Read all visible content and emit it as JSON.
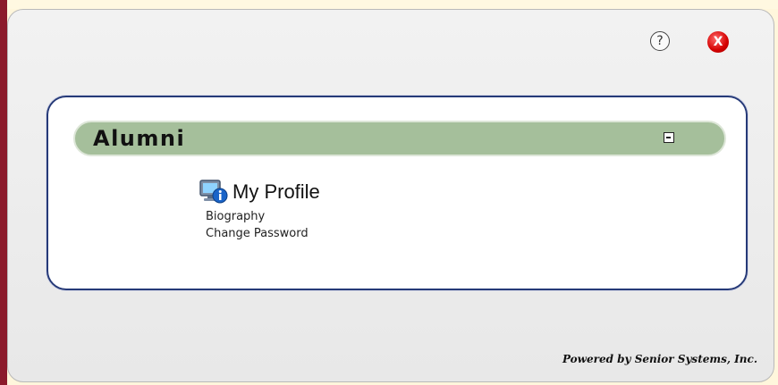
{
  "toolbar": {
    "help_label": "?",
    "close_label": "X"
  },
  "section": {
    "title": "Alumni"
  },
  "profile": {
    "title": "My Profile",
    "links": [
      "Biography",
      "Change Password"
    ]
  },
  "footer": {
    "text": "Powered by Senior Systems, Inc."
  },
  "colors": {
    "header_green": "#a5bf9b",
    "card_border": "#263a78",
    "close_red": "#d40000",
    "left_band": "#8b1a2b"
  }
}
